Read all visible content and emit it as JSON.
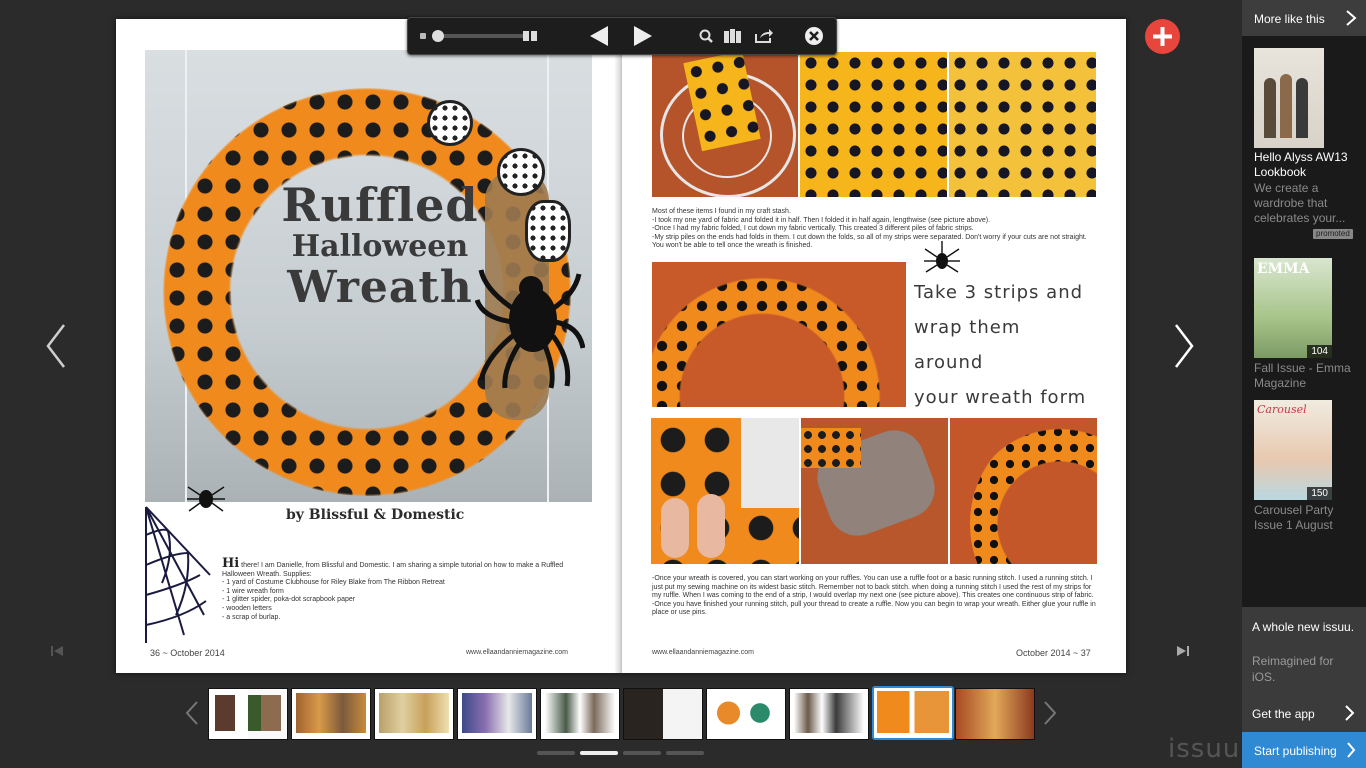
{
  "toolbar": {
    "zoom_level": 0.12,
    "icons": [
      "zoom-slider",
      "pages-icon",
      "previous-page-icon",
      "next-page-icon",
      "search-icon",
      "stack-icon",
      "share-icon",
      "close-icon"
    ]
  },
  "add_button": {
    "icon": "plus-icon",
    "color": "#e8453c"
  },
  "magazine": {
    "left_page": {
      "title_line1": "Ruffled",
      "title_line2": "Halloween",
      "title_line3": "Wreath",
      "byline": "by Blissful & Domestic",
      "intro_lead": "Hi",
      "intro_text": " there! I am Danielle, from Blissful and Domestic. I am sharing a simple tutorial on how to make a Ruffled Halloween Wreath. Supplies:",
      "supplies": [
        "- 1 yard of Costume Clubhouse for Riley Blake from The Ribbon Retreat",
        "- 1 wire wreath form",
        "- 1 glitter spider, poka-dot scrapbook paper",
        "- wooden letters",
        "- a scrap of burlap."
      ],
      "footer_left": "36 ~ October 2014",
      "footer_url": "www.ellaandanniemagazine.com"
    },
    "right_page": {
      "steps_text": [
        "Most of these items I found in my craft stash.",
        "-I took my one yard of fabric and folded it in half. Then I folded it in half again, lengthwise (see picture above).",
        "-Once I had my fabric folded, I cut down my fabric vertically. This created 3 different piles of fabric strips.",
        "-My strip piles on the ends had folds in them. I cut down the folds, so all of my strips were separated. Don't worry if your cuts are not straight. You won't be able to tell once the wreath is finished."
      ],
      "caption": "Take 3 strips and wrap them around your wreath form",
      "caption_lines": [
        "Take 3 strips and",
        "wrap them around",
        "your wreath form"
      ],
      "bottom_text": [
        "-Once your wreath is covered, you can start working on your ruffles. You can use a ruffle foot or a basic running stitch. I used a running stitch. I just put my sewing machine on its widest basic stitch. Remember not to back stitch. when doing a running stitch I used the rest of my strips for my ruffle. When I was coming to the end of a strip, I would overlap my next one (see picture above). This creates one continuous strip of fabric.",
        "-Once you have finished your running stitch, pull your thread to create a ruffle. Now you can begin to wrap your wreath. Either glue your ruffle in place or use pins."
      ],
      "footer_url": "www.ellaandanniemagazine.com",
      "footer_right": "October 2014 ~ 37"
    }
  },
  "sidebar": {
    "header": "More like this",
    "items": [
      {
        "title": "Hello Alyss AW13 Lookbook",
        "subtitle": "We create a wardrobe that celebrates your...",
        "badge": "promoted"
      },
      {
        "title": "",
        "subtitle": "Fall Issue - Emma Magazine",
        "count": "104",
        "cover_label": "EMMA"
      },
      {
        "title": "",
        "subtitle": "Carousel Party Issue 1 August",
        "count": "150",
        "cover_label": "Carousel"
      }
    ],
    "promo_title": "A whole new issuu.",
    "promo_sub": "Reimagined for iOS.",
    "promo_link": "Get the app",
    "start_publishing": "Start publishing",
    "accent": "#2f8ad3"
  },
  "brand": "issuu",
  "thumbnails": {
    "count": 10,
    "selected_index": 8
  },
  "pagination": {
    "pages": 4,
    "current": 2
  }
}
